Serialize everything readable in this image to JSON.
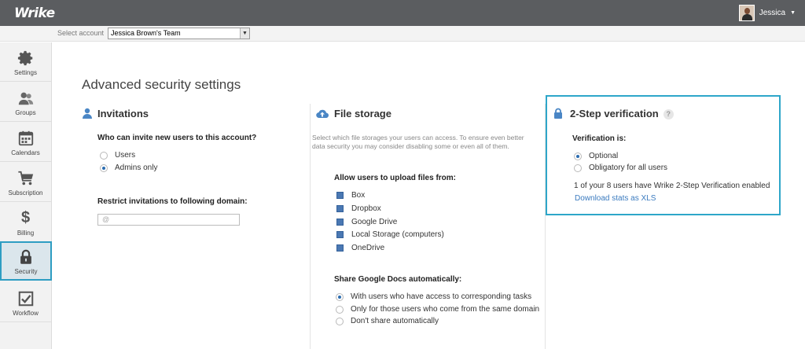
{
  "app": {
    "logo": "Wrike"
  },
  "user": {
    "name": "Jessica"
  },
  "account": {
    "label": "Select account",
    "value": "Jessica Brown's Team"
  },
  "sidebar": {
    "items": [
      {
        "label": "Settings",
        "icon": "gear-icon"
      },
      {
        "label": "Groups",
        "icon": "users-icon"
      },
      {
        "label": "Calendars",
        "icon": "calendar-icon"
      },
      {
        "label": "Subscription",
        "icon": "cart-icon"
      },
      {
        "label": "Billing",
        "icon": "dollar-icon",
        "glyph": "$"
      },
      {
        "label": "Security",
        "icon": "lock-icon",
        "active": true
      },
      {
        "label": "Workflow",
        "icon": "checkbox-icon"
      }
    ]
  },
  "page": {
    "title": "Advanced security settings"
  },
  "invitations": {
    "title": "Invitations",
    "question": "Who can invite new users to this account?",
    "options": [
      {
        "label": "Users",
        "selected": false
      },
      {
        "label": "Admins only",
        "selected": true
      }
    ],
    "domain_label": "Restrict invitations to following domain:",
    "domain_placeholder": "@"
  },
  "file_storage": {
    "title": "File storage",
    "description": "Select which file storages your users can access. To ensure even better data security you may consider disabling some or even all of them.",
    "upload_label": "Allow users to upload files from:",
    "sources": [
      {
        "label": "Box",
        "checked": true
      },
      {
        "label": "Dropbox",
        "checked": true
      },
      {
        "label": "Google Drive",
        "checked": true
      },
      {
        "label": "Local Storage (computers)",
        "checked": true
      },
      {
        "label": "OneDrive",
        "checked": true
      }
    ],
    "share_label": "Share Google Docs automatically:",
    "share_options": [
      {
        "label": "With users who have access to corresponding tasks",
        "selected": true
      },
      {
        "label": "Only for those users who come from the same domain",
        "selected": false
      },
      {
        "label": "Don't share automatically",
        "selected": false
      }
    ]
  },
  "two_step": {
    "title": "2-Step verification",
    "help": "?",
    "verification_label": "Verification is:",
    "options": [
      {
        "label": "Optional",
        "selected": true
      },
      {
        "label": "Obligatory for all users",
        "selected": false
      }
    ],
    "stats_text": "1 of your 8 users have Wrike 2-Step Verification enabled",
    "download_link": "Download stats as XLS"
  },
  "colors": {
    "topbar": "#5b5d60",
    "accent": "#2ea6c9",
    "link": "#3b7bbf",
    "checkbox": "#4a78b3"
  }
}
